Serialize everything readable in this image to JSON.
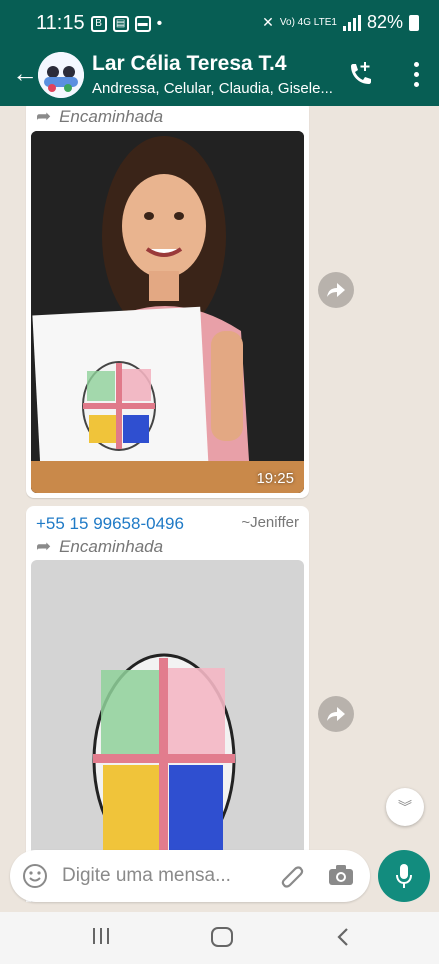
{
  "status_bar": {
    "time": "11:15",
    "icons": [
      "b-icon",
      "gallery-icon",
      "screen-icon"
    ],
    "dot": "•",
    "network": "Vo) 4G LTE1",
    "battery_percent": "82%"
  },
  "header": {
    "back_icon": "arrow-left-icon",
    "group_title": "Lar Célia Teresa T.4",
    "participants": "Andressa, Celular, Claudia, Gisele...",
    "call_icon": "add-call-icon",
    "menu_icon": "more-vertical-icon"
  },
  "messages": [
    {
      "forwarded_label": "Encaminhada",
      "time": "19:25",
      "image_desc_icon": "photo-icon"
    },
    {
      "sender_phone": "+55 15 99658-0496",
      "sender_name": "~Jeniffer",
      "forwarded_label": "Encaminhada",
      "image_desc_icon": "photo-icon"
    }
  ],
  "input": {
    "placeholder": "Digite uma mensa...",
    "emoji_icon": "emoji-icon",
    "attach_icon": "paperclip-icon",
    "camera_icon": "camera-icon",
    "mic_icon": "mic-icon"
  },
  "colors": {
    "header": "#075e54",
    "chat_bg": "#ece5dd",
    "accent": "#128c7e",
    "sender": "#1f7ac6"
  }
}
